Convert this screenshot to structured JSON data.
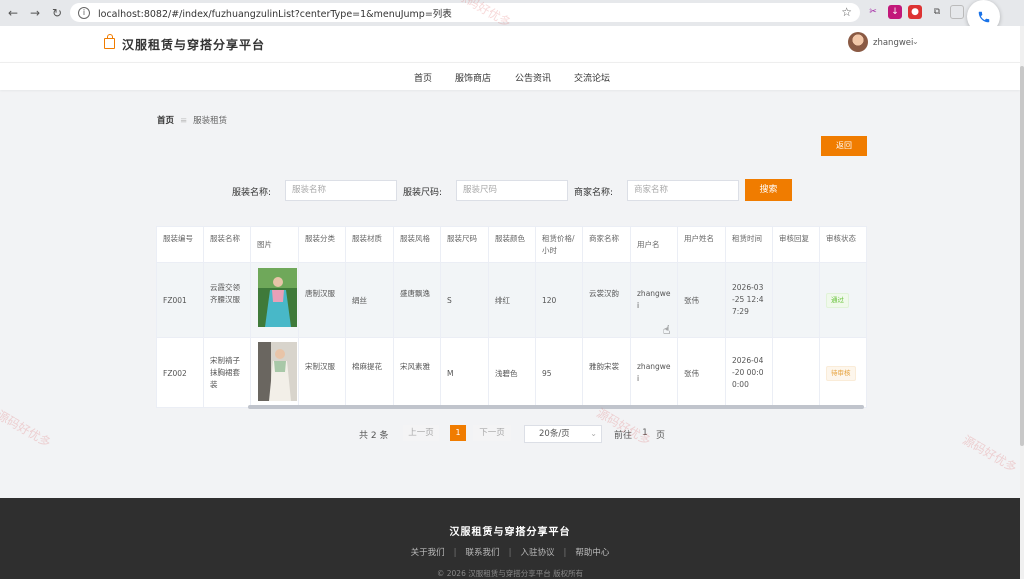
{
  "browser": {
    "url": "localhost:8082/#/index/fuzhuangzulinList?centerType=1&menuJump=列表"
  },
  "header": {
    "site_title": "汉服租赁与穿搭分享平台",
    "user_name": "zhangwei"
  },
  "menu": [
    "首页",
    "服饰商店",
    "公告资讯",
    "交流论坛"
  ],
  "breadcrumb": {
    "home": "首页",
    "current": "服装租赁"
  },
  "back_button": "返回",
  "search": {
    "fields": [
      {
        "label": "服装名称:",
        "placeholder": "服装名称"
      },
      {
        "label": "服装尺码:",
        "placeholder": "服装尺码"
      },
      {
        "label": "商家名称:",
        "placeholder": "商家名称"
      }
    ],
    "button": "搜索"
  },
  "table": {
    "columns": [
      "服装编号",
      "服装名称",
      "图片",
      "服装分类",
      "服装材质",
      "服装风格",
      "服装尺码",
      "服装颜色",
      "租赁价格/小时",
      "商家名称",
      "用户名",
      "用户姓名",
      "租赁时间",
      "审核回复",
      "审核状态"
    ],
    "rows": [
      {
        "code": "FZ001",
        "name": "云霞交领齐腰汉服",
        "category": "唐制汉服",
        "material": "绢丝",
        "style": "盛唐飘逸",
        "size": "S",
        "color": "绯红",
        "price": "120",
        "shop": "云裳汉韵",
        "username": "zhangwei",
        "realname": "张伟",
        "time": "2026-03-25 12:47:29",
        "reply": "",
        "status": "通过"
      },
      {
        "code": "FZ002",
        "name": "宋制褙子抹胸裙套装",
        "category": "宋制汉服",
        "material": "棉麻提花",
        "style": "宋风素雅",
        "size": "M",
        "color": "浅碧色",
        "price": "95",
        "shop": "雅韵宋裳",
        "username": "zhangwei",
        "realname": "张伟",
        "time": "2026-04-20 00:00:00",
        "reply": "",
        "status": "待审核"
      }
    ]
  },
  "pagination": {
    "total": "共 2 条",
    "prev": "上一页",
    "page": "1",
    "next": "下一页",
    "page_size": "20条/页",
    "goto_label": "前往",
    "goto_value": "1",
    "goto_unit": "页"
  },
  "footer": {
    "title": "汉服租赁与穿搭分享平台",
    "links": [
      "关于我们",
      "联系我们",
      "入驻协议",
      "帮助中心"
    ],
    "copyright": "© 2026 汉服租赁与穿搭分享平台 版权所有"
  },
  "watermark": "源码好优多",
  "colors": {
    "accent": "#f07c00",
    "footer_bg": "#2f2f2f",
    "page_bg": "#f2f3f5"
  }
}
